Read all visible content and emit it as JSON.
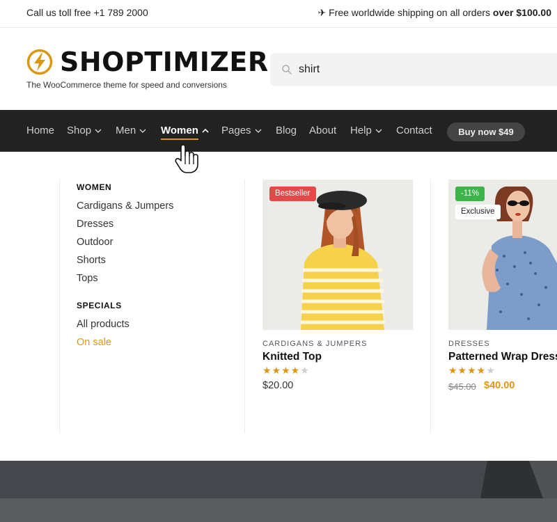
{
  "topbar": {
    "phone_text": "Call us toll free +1 789 2000",
    "shipping_prefix": "✈ Free worldwide shipping on all orders ",
    "shipping_bold": "over $100.00"
  },
  "header": {
    "brand": "SHOPTIMIZER",
    "tagline": "The WooCommerce theme for speed and conversions",
    "search_value": "shirt",
    "colors": {
      "accent": "#dc9814",
      "nav_bg": "#222222"
    }
  },
  "nav": {
    "items": [
      {
        "label": "Home",
        "chevron": false
      },
      {
        "label": "Shop",
        "chevron": "down"
      },
      {
        "label": "Men",
        "chevron": "down"
      },
      {
        "label": "Women",
        "chevron": "up",
        "active": true
      },
      {
        "label": "Pages",
        "chevron": "down"
      },
      {
        "label": "Blog",
        "chevron": false
      },
      {
        "label": "About",
        "chevron": false
      },
      {
        "label": "Help",
        "chevron": "down"
      },
      {
        "label": "Contact",
        "chevron": false
      }
    ],
    "buy_button": "Buy now $49"
  },
  "mega_menu": {
    "women_heading": "WOMEN",
    "women_links": [
      "Cardigans & Jumpers",
      "Dresses",
      "Outdoor",
      "Shorts",
      "Tops"
    ],
    "specials_heading": "SPECIALS",
    "specials_links": [
      "All products",
      "On sale"
    ],
    "products": [
      {
        "badges": [
          "Bestseller"
        ],
        "category": "CARDIGANS & JUMPERS",
        "title": "Knitted Top",
        "rating": 4,
        "price": "$20.00"
      },
      {
        "badges": [
          "-11%",
          "Exclusive"
        ],
        "category": "DRESSES",
        "title": "Patterned Wrap Dress",
        "rating": 4,
        "price_old": "$45.00",
        "price_new": "$40.00"
      }
    ]
  }
}
